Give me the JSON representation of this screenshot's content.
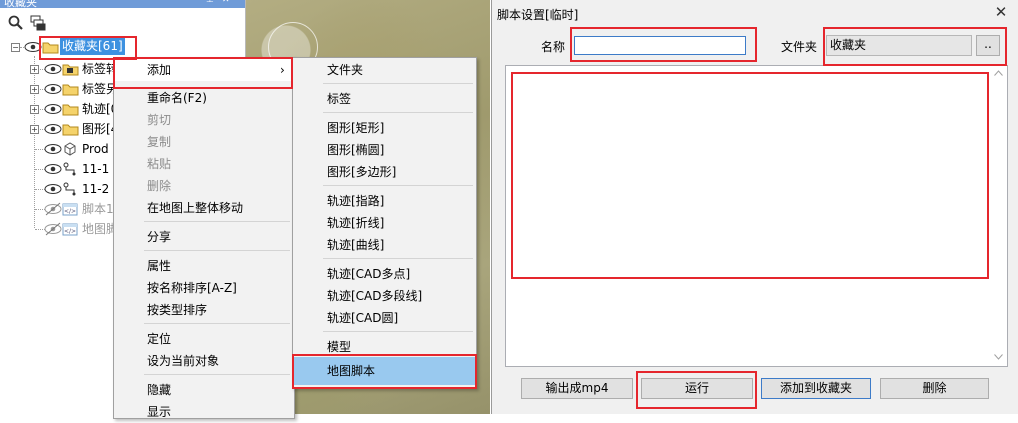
{
  "left_panel": {
    "title": "收藏夹",
    "tree": {
      "root_label": "收藏夹[61]",
      "items": [
        {
          "label": "标签转",
          "icon": "tag-folder-icon",
          "disabled": false
        },
        {
          "label": "标签另",
          "icon": "folder-icon",
          "disabled": false
        },
        {
          "label": "轨迹[0",
          "icon": "folder-icon",
          "disabled": false
        },
        {
          "label": "图形[4",
          "icon": "folder-icon",
          "disabled": false
        },
        {
          "label": "Prod",
          "icon": "cube-icon",
          "disabled": false
        },
        {
          "label": "11-1",
          "icon": "track-icon",
          "disabled": false
        },
        {
          "label": "11-2",
          "icon": "track-icon",
          "disabled": false
        },
        {
          "label": "脚本1",
          "icon": "script-icon",
          "disabled": true
        },
        {
          "label": "地图脚",
          "icon": "script-icon",
          "disabled": true
        }
      ]
    }
  },
  "context_menu": {
    "items": [
      {
        "label": "添加",
        "has_submenu": true,
        "disabled": false
      },
      {
        "label": "重命名(F2)",
        "disabled": false
      },
      {
        "label": "剪切",
        "disabled": true
      },
      {
        "label": "复制",
        "disabled": true
      },
      {
        "label": "粘贴",
        "disabled": true
      },
      {
        "label": "删除",
        "disabled": true
      },
      {
        "label": "在地图上整体移动",
        "disabled": false
      },
      {
        "label": "分享",
        "disabled": false
      },
      {
        "label": "属性",
        "disabled": false
      },
      {
        "label": "按名称排序[A-Z]",
        "disabled": false
      },
      {
        "label": "按类型排序",
        "disabled": false
      },
      {
        "label": "定位",
        "disabled": false
      },
      {
        "label": "设为当前对象",
        "disabled": false
      },
      {
        "label": "隐藏",
        "disabled": false
      },
      {
        "label": "显示",
        "disabled": false
      }
    ],
    "submenu_arrow": "›"
  },
  "submenu": {
    "items": [
      {
        "label": "文件夹"
      },
      {
        "label": "标签"
      },
      {
        "label": "图形[矩形]"
      },
      {
        "label": "图形[椭圆]"
      },
      {
        "label": "图形[多边形]"
      },
      {
        "label": "轨迹[指路]"
      },
      {
        "label": "轨迹[折线]"
      },
      {
        "label": "轨迹[曲线]"
      },
      {
        "label": "轨迹[CAD多点]"
      },
      {
        "label": "轨迹[CAD多段线]"
      },
      {
        "label": "轨迹[CAD圆]"
      },
      {
        "label": "模型"
      },
      {
        "label": "地图脚本",
        "highlighted": true
      }
    ]
  },
  "dialog": {
    "title": "脚本设置[临时]",
    "close_glyph": "✕",
    "name_label": "名称",
    "name_value": "",
    "folder_label": "文件夹",
    "folder_value": "收藏夹",
    "browse_label": "..",
    "script_content": "",
    "buttons": {
      "export_mp4": "输出成mp4",
      "run": "运行",
      "add_to_favorites": "添加到收藏夹",
      "delete": "删除"
    }
  },
  "colors": {
    "highlight": "#99c9ef",
    "root_selected": "#3d91e0",
    "annotation_red": "#e5262d",
    "header_blue": "#6f9bd8"
  }
}
